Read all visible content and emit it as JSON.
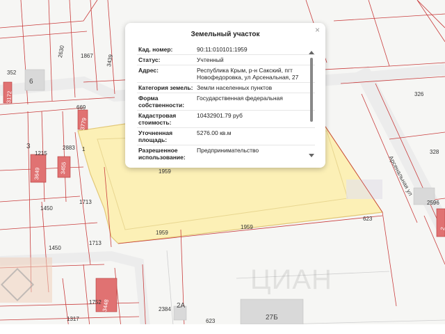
{
  "map": {
    "labels": {
      "l352": "352",
      "l6": "6",
      "l2630": "2630",
      "l1867": "1867",
      "l3439": "3439",
      "l3172": "3172",
      "l669": "669",
      "l3779": "3779",
      "l3": "3",
      "l1215": "1215",
      "l3649": "3649",
      "l2883": "2883",
      "l3455": "3455",
      "l1": "1",
      "l1959a": "1959",
      "l1450a": "1450",
      "l1713a": "1713",
      "l1450b": "1450",
      "l1713b": "1713",
      "l1959b": "1959",
      "l1959c": "1959",
      "l623a": "623",
      "l326": "326",
      "l328": "328",
      "l2596": "2596",
      "l2": "2",
      "street": "Арсенальная ул",
      "l2384": "2384",
      "l1752": "1752",
      "l3448": "3448",
      "l1317": "1317",
      "l2A": "2А",
      "l623b": "623",
      "l27b": "27Б"
    },
    "watermark": "ЦИАН",
    "colors": {
      "parcel_fill": "#fdf0b0",
      "parcel_stroke": "#e0c36a",
      "boundary": "#c93c3c",
      "building": "#e07272"
    }
  },
  "popup": {
    "title": "Земельный участок",
    "close_icon": "×",
    "rows": [
      {
        "label": "Кад. номер:",
        "value": "90:11:010101:1959"
      },
      {
        "label": "Статус:",
        "value": "Учтенный"
      },
      {
        "label": "Адрес:",
        "value": "Республика Крым, р-н Сакский, пгт Новофедоровка, ул Арсенальная, 27"
      },
      {
        "label": "Категория земель:",
        "value": "Земли населенных пунктов"
      },
      {
        "label": "Форма собственности:",
        "value": "Государственная федеральная"
      },
      {
        "label": "Кадастровая стоимость:",
        "value": "10432901.79 руб"
      },
      {
        "label": "Уточненная площадь:",
        "value": "5276.00 кв.м"
      },
      {
        "label": "Разрешенное использование:",
        "value": "Предпринимательство"
      }
    ]
  }
}
